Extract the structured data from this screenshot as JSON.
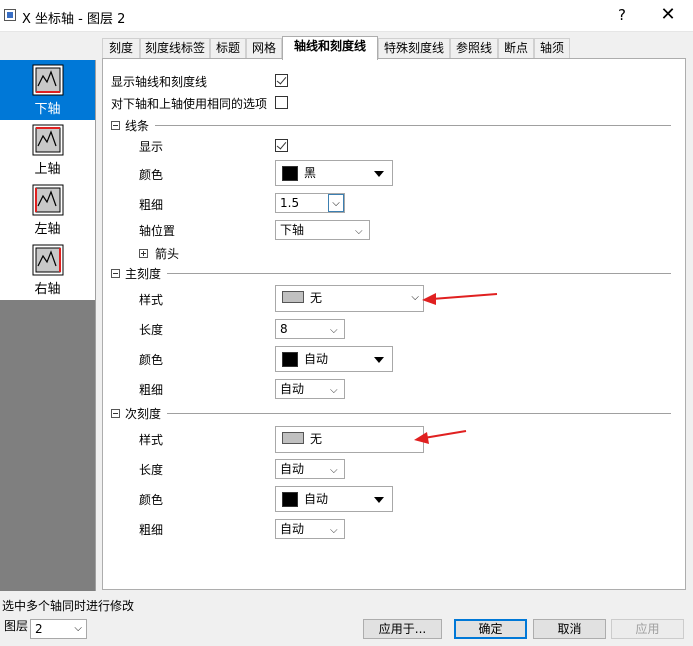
{
  "window": {
    "title": "X 坐标轴 - 图层 2",
    "help_label": "?",
    "close_label": "✕"
  },
  "sidebar": {
    "items": [
      {
        "label": "下轴",
        "icon": "bottom-axis-icon",
        "selected": true
      },
      {
        "label": "上轴",
        "icon": "top-axis-icon",
        "selected": false
      },
      {
        "label": "左轴",
        "icon": "left-axis-icon",
        "selected": false
      },
      {
        "label": "右轴",
        "icon": "right-axis-icon",
        "selected": false
      }
    ]
  },
  "tabs": [
    {
      "label": "刻度"
    },
    {
      "label": "刻度线标签"
    },
    {
      "label": "标题"
    },
    {
      "label": "网格"
    },
    {
      "label": "轴线和刻度线",
      "active": true
    },
    {
      "label": "特殊刻度线"
    },
    {
      "label": "参照线"
    },
    {
      "label": "断点"
    },
    {
      "label": "轴须"
    }
  ],
  "panel": {
    "show_axis_ticks_label": "显示轴线和刻度线",
    "show_axis_ticks_checked": true,
    "same_options_label": "对下轴和上轴使用相同的选项",
    "same_options_checked": false,
    "line": {
      "section_label": "线条",
      "show_label": "显示",
      "show_checked": true,
      "color_label": "颜色",
      "color_value": "黑",
      "color_swatch": "#000000",
      "thickness_label": "粗细",
      "thickness_value": "1.5",
      "position_label": "轴位置",
      "position_value": "下轴",
      "arrow_label": "箭头"
    },
    "major": {
      "section_label": "主刻度",
      "style_label": "样式",
      "style_value": "无",
      "length_label": "长度",
      "length_value": "8",
      "color_label": "颜色",
      "color_value": "自动",
      "thickness_label": "粗细",
      "thickness_value": "自动"
    },
    "minor": {
      "section_label": "次刻度",
      "style_label": "样式",
      "style_value": "无",
      "length_label": "长度",
      "length_value": "自动",
      "color_label": "颜色",
      "color_value": "自动",
      "thickness_label": "粗细",
      "thickness_value": "自动"
    }
  },
  "footer": {
    "status": "选中多个轴同时进行修改",
    "layer_label": "图层",
    "layer_value": "2",
    "apply_to_label": "应用于...",
    "ok_label": "确定",
    "cancel_label": "取消",
    "apply_label": "应用"
  },
  "colors": {
    "selection": "#0078d7",
    "annotation_arrow": "#e02020",
    "swatch_gray": "#c0c0c0"
  }
}
